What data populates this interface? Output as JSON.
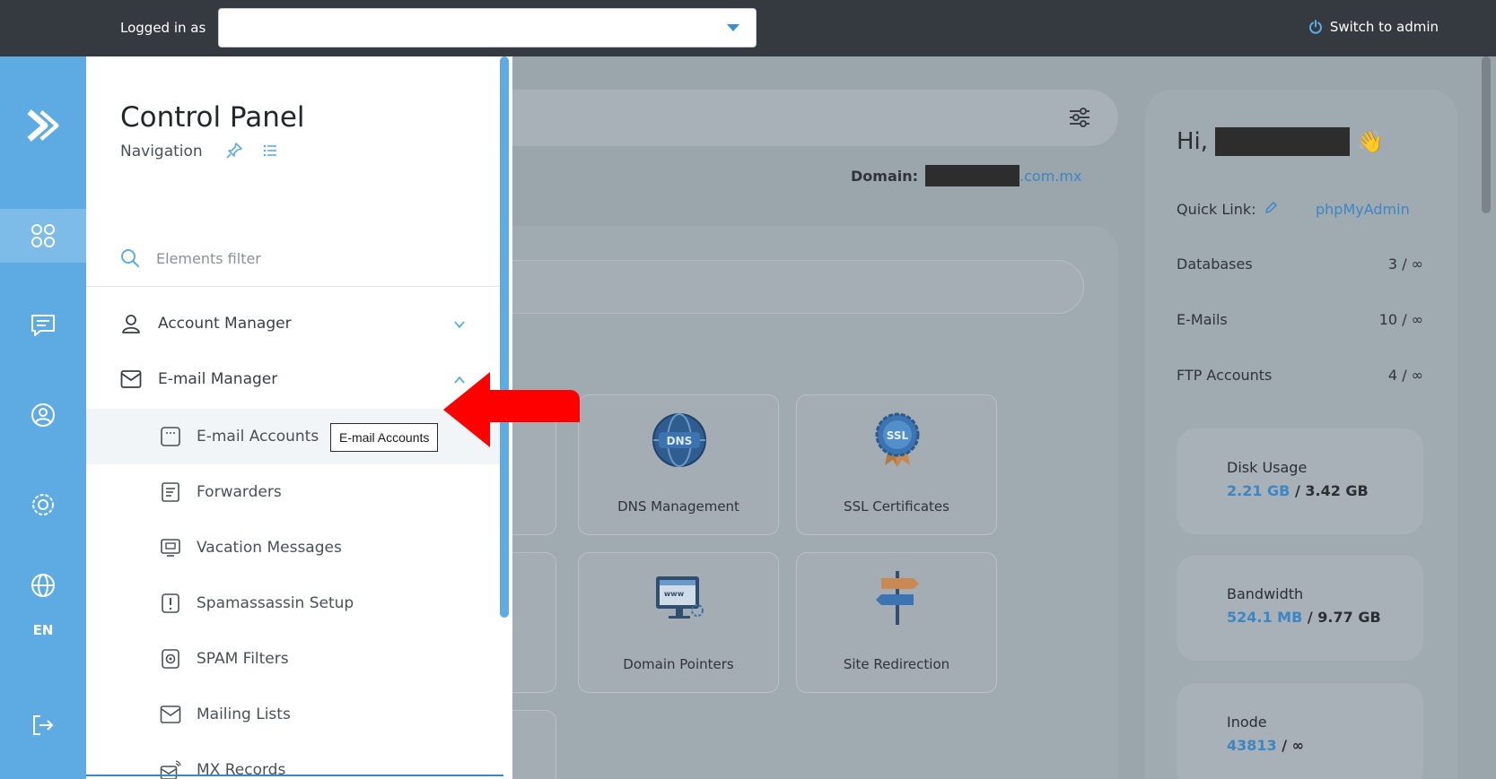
{
  "topbar": {
    "logged_in_label": "Logged in as",
    "user_value": "",
    "switch_admin_label": "Switch to admin"
  },
  "rail": {
    "items": [
      "apps-icon",
      "chat-icon",
      "user-circle-icon",
      "settings-icon",
      "globe-icon",
      "logout-icon"
    ],
    "language": "EN"
  },
  "drawer": {
    "title": "Control Panel",
    "subtitle": "Navigation",
    "filter_placeholder": "Elements filter",
    "groups": [
      {
        "label": "Account Manager",
        "expanded": false
      },
      {
        "label": "E-mail Manager",
        "expanded": true
      }
    ],
    "email_items": [
      {
        "label": "E-mail Accounts",
        "icon": "email-accounts-icon"
      },
      {
        "label": "Forwarders",
        "icon": "forwarders-icon"
      },
      {
        "label": "Vacation Messages",
        "icon": "vacation-messages-icon"
      },
      {
        "label": "Spamassassin Setup",
        "icon": "spamassassin-icon"
      },
      {
        "label": "SPAM Filters",
        "icon": "spam-filters-icon"
      },
      {
        "label": "Mailing Lists",
        "icon": "mailing-lists-icon"
      },
      {
        "label": "MX Records",
        "icon": "mx-records-icon"
      }
    ]
  },
  "tooltip": {
    "text": "E-mail Accounts"
  },
  "main": {
    "domain_label": "Domain:",
    "domain_suffix": ".com.mx",
    "tiles": [
      {
        "label": "DNS Management",
        "icon": "dns-icon"
      },
      {
        "label": "SSL Certificates",
        "icon": "ssl-icon"
      },
      {
        "label": "Domain Pointers",
        "icon": "domain-pointers-icon"
      },
      {
        "label": "Site Redirection",
        "icon": "signpost-icon"
      }
    ]
  },
  "right": {
    "greeting": "Hi,",
    "quick_link_label": "Quick Link:",
    "quick_link_value": "phpMyAdmin",
    "stats": [
      {
        "label": "Databases",
        "value": "3 / ∞"
      },
      {
        "label": "E-Mails",
        "value": "10 / ∞"
      },
      {
        "label": "FTP Accounts",
        "value": "4 / ∞"
      }
    ],
    "usage": [
      {
        "title": "Disk Usage",
        "used": "2.21 GB",
        "sep": "/",
        "total": "3.42 GB"
      },
      {
        "title": "Bandwidth",
        "used": "524.1 MB",
        "sep": "/",
        "total": "9.77 GB"
      },
      {
        "title": "Inode",
        "used": "43813",
        "sep": "/",
        "total": "∞"
      }
    ]
  },
  "colors": {
    "topbar": "#343a40",
    "rail": "#5eabe4",
    "accent": "#3d86c4",
    "arrow": "#ff0000"
  }
}
